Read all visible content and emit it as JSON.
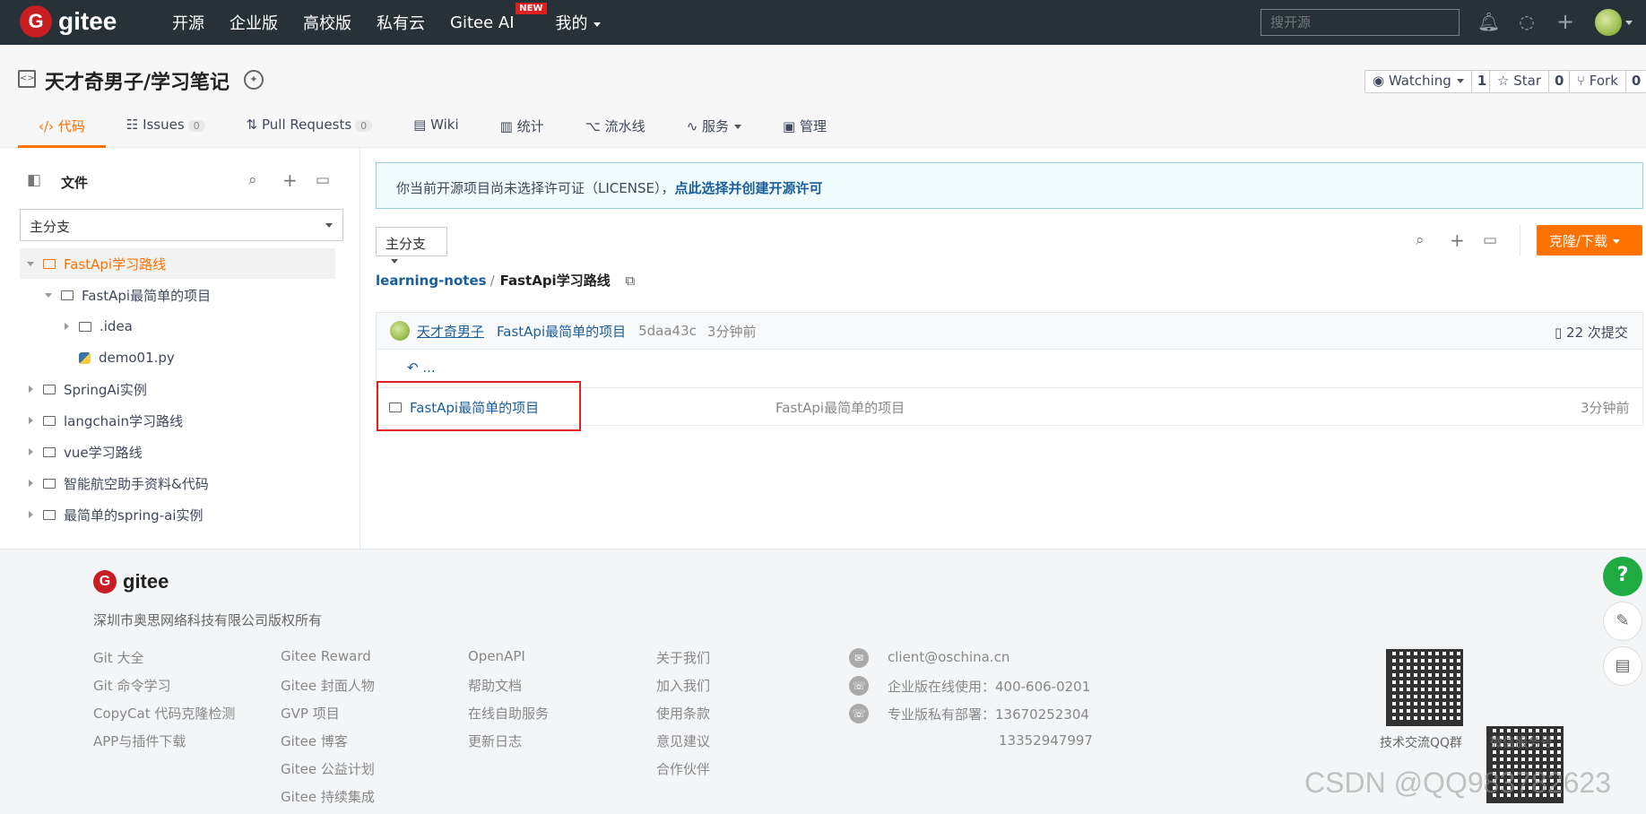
{
  "brand": {
    "name": "gitee"
  },
  "topnav": {
    "items": [
      "开源",
      "企业版",
      "高校版",
      "私有云",
      "Gitee AI",
      "我的"
    ],
    "new_badge": "NEW",
    "search_placeholder": "搜开源"
  },
  "repo": {
    "title": "天才奇男子/学习笔记",
    "watching_label": "Watching",
    "watching_count": "1",
    "star_label": "Star",
    "star_count": "0",
    "fork_label": "Fork",
    "fork_count": "0"
  },
  "tabs": [
    {
      "label": "代码"
    },
    {
      "label": "Issues",
      "count": "0"
    },
    {
      "label": "Pull Requests",
      "count": "0"
    },
    {
      "label": "Wiki"
    },
    {
      "label": "统计"
    },
    {
      "label": "流水线"
    },
    {
      "label": "服务"
    },
    {
      "label": "管理"
    }
  ],
  "sidebar": {
    "title": "文件",
    "branch": "主分支",
    "tree": [
      {
        "label": "FastApi学习路线"
      },
      {
        "label": "FastApi最简单的项目"
      },
      {
        "label": ".idea"
      },
      {
        "label": "demo01.py"
      },
      {
        "label": "SpringAi实例"
      },
      {
        "label": "langchain学习路线"
      },
      {
        "label": "vue学习路线"
      },
      {
        "label": "智能航空助手资料&代码"
      },
      {
        "label": "最简单的spring-ai实例"
      }
    ]
  },
  "main": {
    "notice_text": "你当前开源项目尚未选择许可证（LICENSE），",
    "notice_link": "点此选择并创建开源许可",
    "branch": "主分支",
    "clone_label": "克隆/下载",
    "breadcrumb_repo": "learning-notes",
    "breadcrumb_sep": "/",
    "breadcrumb_dir": "FastApi学习路线",
    "commit": {
      "author": "天才奇男子",
      "message": "FastApi最简单的项目",
      "hash": "5daa43c",
      "time": "3分钟前",
      "total": "22 次提交"
    },
    "back_label": "...",
    "files": [
      {
        "name": "FastApi最简单的项目",
        "message": "FastApi最简单的项目",
        "time": "3分钟前"
      }
    ]
  },
  "footer": {
    "brand": "gitee",
    "copyright": "深圳市奥思网络科技有限公司版权所有",
    "col1": [
      "Git 大全",
      "Git 命令学习",
      "CopyCat 代码克隆检测",
      "APP与插件下载"
    ],
    "col2": [
      "Gitee Reward",
      "Gitee 封面人物",
      "GVP 项目",
      "Gitee 博客",
      "Gitee 公益计划",
      "Gitee 持续集成"
    ],
    "col3": [
      "OpenAPI",
      "帮助文档",
      "在线自助服务",
      "更新日志"
    ],
    "col4": [
      "关于我们",
      "加入我们",
      "使用条款",
      "意见建议",
      "合作伙伴"
    ],
    "email": "client@oschina.cn",
    "phone1": "企业版在线使用：400-606-0201",
    "phone2": "专业版私有部署：13670252304",
    "phone3": "13352947997",
    "qr1_label": "技术交流QQ群",
    "qr2_label": "微信服务号"
  },
  "watermark": "CSDN @QQ983782623"
}
